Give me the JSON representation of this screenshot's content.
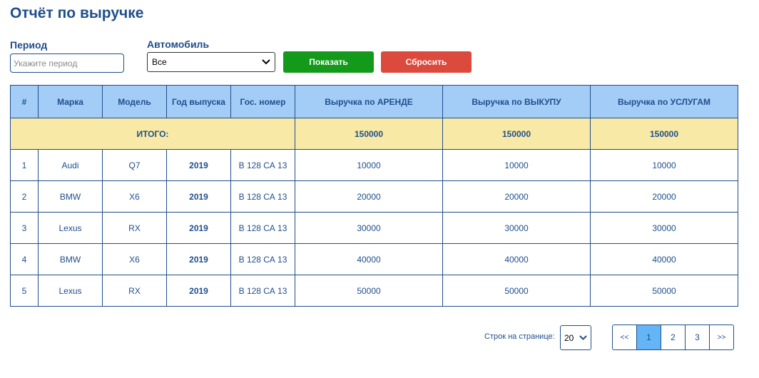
{
  "page": {
    "title": "Отчёт по выручке"
  },
  "filters": {
    "period_label": "Период",
    "period_placeholder": "Укажите период",
    "car_label": "Автомобиль",
    "car_value": "Все",
    "show_button": "Показать",
    "reset_button": "Сбросить"
  },
  "table": {
    "headers": [
      "#",
      "Марка",
      "Модель",
      "Год выпуска",
      "Гос. номер",
      "Выручка по АРЕНДЕ",
      "Выручка по ВЫКУПУ",
      "Выручка по УСЛУГАМ"
    ],
    "total": {
      "label": "ИТОГО:",
      "rent": "150000",
      "buyout": "150000",
      "services": "150000"
    },
    "rows": [
      {
        "n": "1",
        "brand": "Audi",
        "model": "Q7",
        "year": "2019",
        "plate": "В 128 СА 13",
        "rent": "10000",
        "buyout": "10000",
        "services": "10000"
      },
      {
        "n": "2",
        "brand": "BMW",
        "model": "X6",
        "year": "2019",
        "plate": "В 128 СА 13",
        "rent": "20000",
        "buyout": "20000",
        "services": "20000"
      },
      {
        "n": "3",
        "brand": "Lexus",
        "model": "RX",
        "year": "2019",
        "plate": "В 128 СА 13",
        "rent": "30000",
        "buyout": "30000",
        "services": "30000"
      },
      {
        "n": "4",
        "brand": "BMW",
        "model": "X6",
        "year": "2019",
        "plate": "В 128 СА 13",
        "rent": "40000",
        "buyout": "40000",
        "services": "40000"
      },
      {
        "n": "5",
        "brand": "Lexus",
        "model": "RX",
        "year": "2019",
        "plate": "В 128 СА 13",
        "rent": "50000",
        "buyout": "50000",
        "services": "50000"
      }
    ]
  },
  "pagination": {
    "rows_label": "Строк на странице:",
    "rows_value": "20",
    "prev": "<<",
    "pages": [
      "1",
      "2",
      "3"
    ],
    "active_page": "1",
    "next": ">>"
  },
  "icons": {
    "select_arrow": "chevron-down-icon"
  },
  "colors": {
    "accent": "#1f4e8c",
    "show": "#149a1b",
    "reset": "#dc4a3d",
    "header": "#a3cdf7",
    "total": "#f8eaa6",
    "active_page": "#64b5f6"
  }
}
